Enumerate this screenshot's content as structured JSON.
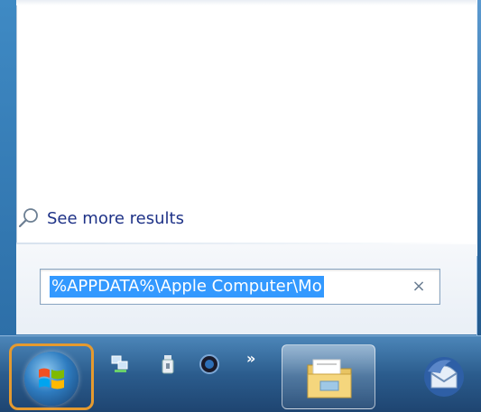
{
  "start_menu": {
    "see_more_label": "See more results",
    "search": {
      "value": "%APPDATA%\\Apple Computer\\Mo",
      "clear_glyph": "×"
    }
  },
  "taskbar": {
    "overflow_label": "»",
    "icons": [
      "windows-logo-icon",
      "network-icon",
      "usb-drive-icon",
      "media-icon",
      "folder-icon",
      "thunderbird-icon"
    ]
  },
  "colors": {
    "selection": "#3399ff",
    "start_highlight": "#e59a2f",
    "link_text": "#1e3287"
  }
}
